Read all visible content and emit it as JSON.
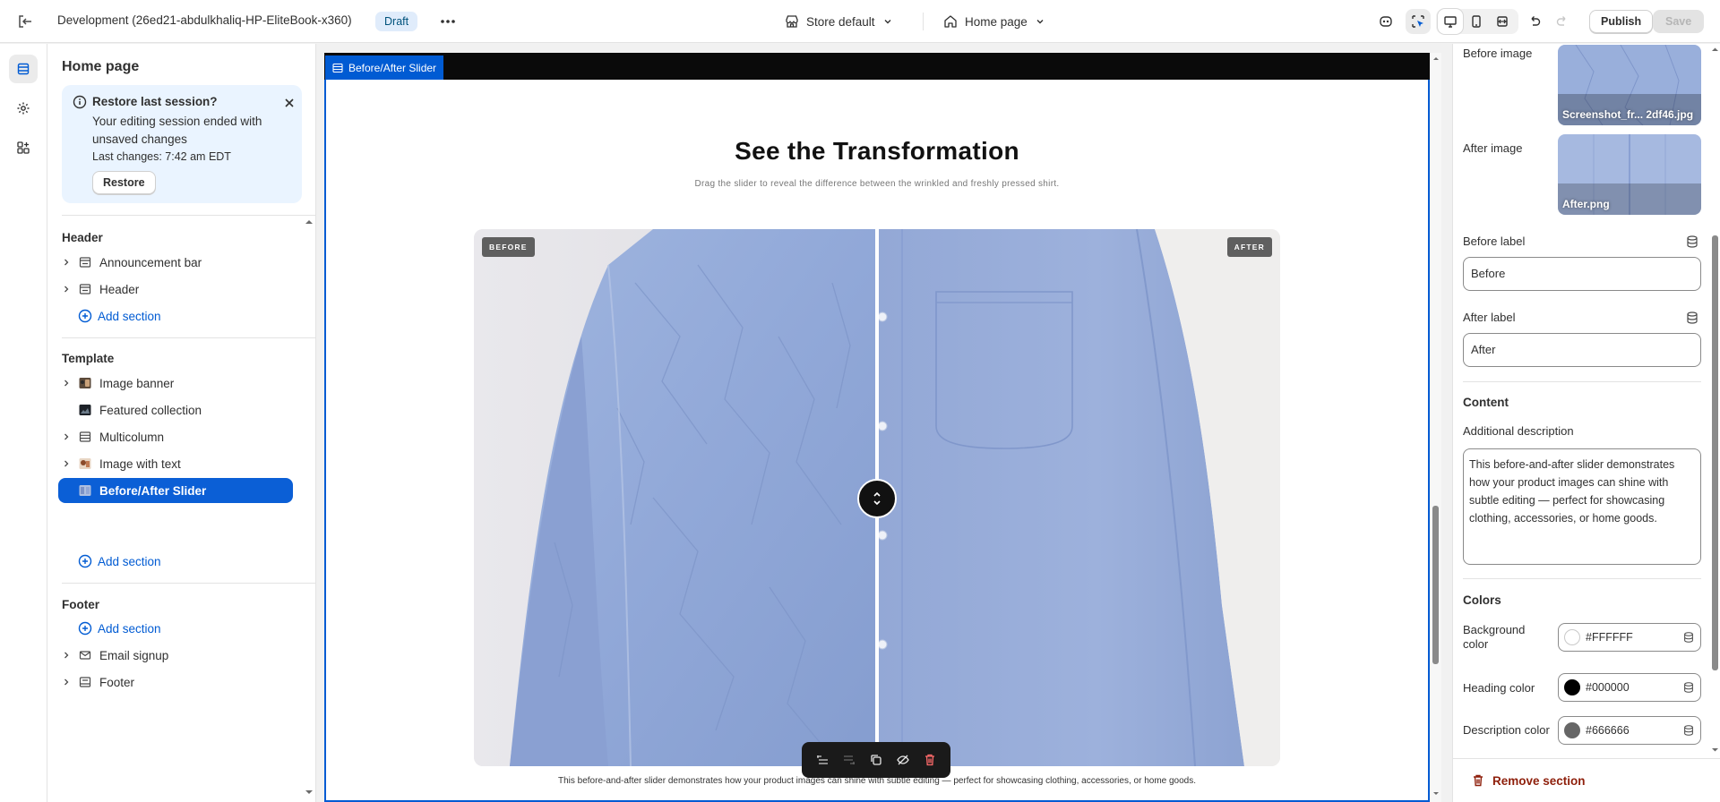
{
  "topbar": {
    "theme_name": "Development (26ed21-abdulkhaliq-HP-EliteBook-x360)",
    "status_badge": "Draft",
    "store_selector": "Store default",
    "page_selector": "Home page",
    "publish_label": "Publish",
    "save_label": "Save"
  },
  "left_panel": {
    "title": "Home page",
    "restore_banner": {
      "title": "Restore last session?",
      "body": "Your editing session ended with unsaved changes",
      "last_changes": "Last changes: 7:42 am EDT",
      "restore_label": "Restore"
    },
    "header_group": {
      "title": "Header",
      "items": [
        {
          "label": "Announcement bar",
          "icon": "section-icon"
        },
        {
          "label": "Header",
          "icon": "section-icon"
        }
      ],
      "add_label": "Add section"
    },
    "template_group": {
      "title": "Template",
      "items": [
        {
          "label": "Image banner",
          "icon": "image-thumb"
        },
        {
          "label": "Featured collection",
          "icon": "image-thumb"
        },
        {
          "label": "Multicolumn",
          "icon": "columns-icon"
        },
        {
          "label": "Image with text",
          "icon": "image-thumb"
        },
        {
          "label": "Before/After Slider",
          "icon": "image-thumb",
          "selected": true
        }
      ],
      "add_label": "Add section"
    },
    "footer_group": {
      "title": "Footer",
      "add_label": "Add section",
      "items": [
        {
          "label": "Email signup",
          "icon": "mail-icon"
        },
        {
          "label": "Footer",
          "icon": "section-icon"
        }
      ]
    }
  },
  "canvas": {
    "section_tag": "Before/After Slider",
    "heading": "See the Transformation",
    "subheading": "Drag the slider to reveal the difference between the wrinkled and freshly pressed shirt.",
    "before_label": "BEFORE",
    "after_label": "AFTER",
    "slider_position": 0.5,
    "footer_text": "This before-and-after slider demonstrates how your product images can shine with subtle editing — perfect for showcasing clothing, accessories, or home goods."
  },
  "right_panel": {
    "before_image_label": "Before image",
    "before_image_file": "Screenshot_fr... 2df46.jpg",
    "after_image_label": "After image",
    "after_image_file": "After.png",
    "before_label_title": "Before label",
    "before_label_value": "Before",
    "after_label_title": "After label",
    "after_label_value": "After",
    "content_heading": "Content",
    "description_label": "Additional description",
    "description_value": "This before-and-after slider demonstrates how your product images can shine with subtle editing — perfect for showcasing clothing, accessories, or home goods.",
    "colors_heading": "Colors",
    "background_color_label": "Background color",
    "background_color_value": "#FFFFFF",
    "heading_color_label": "Heading color",
    "heading_color_value": "#000000",
    "description_color_label": "Description color",
    "description_color_value": "#666666",
    "remove_label": "Remove section"
  },
  "colors": {
    "accent": "#005BD3",
    "selected_row": "#0B5FD6",
    "danger": "#8E1F0B"
  }
}
